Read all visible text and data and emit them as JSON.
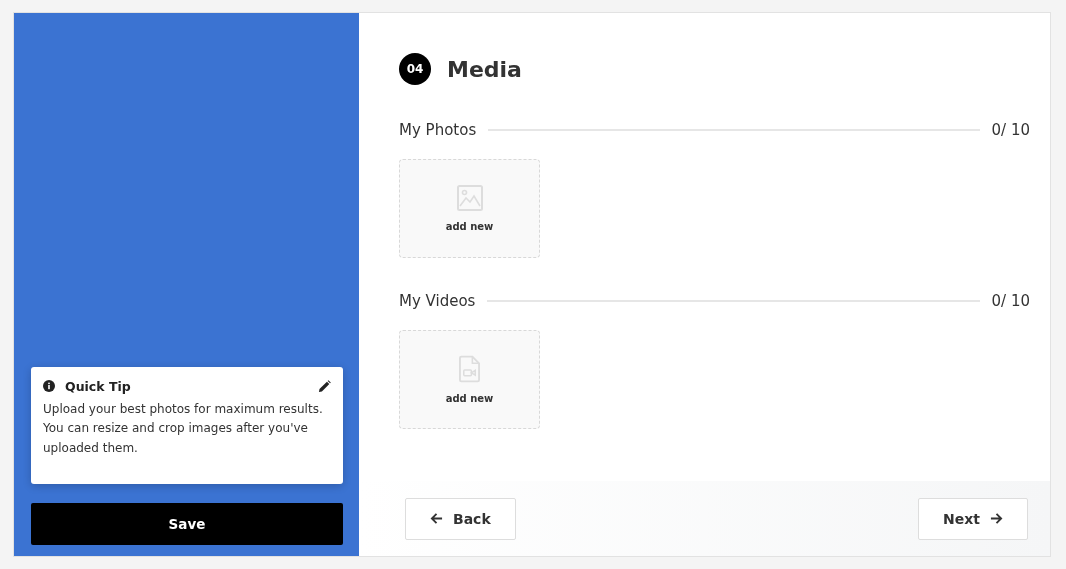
{
  "step": {
    "number": "04",
    "title": "Media"
  },
  "sections": [
    {
      "kind": "photo",
      "title": "My Photos",
      "count": "0/ 10",
      "tile_label": "add new"
    },
    {
      "kind": "video",
      "title": "My Videos",
      "count": "0/ 10",
      "tile_label": "add new"
    }
  ],
  "tip": {
    "title": "Quick Tip",
    "text": "Upload your best photos for maximum results. You can resize and crop images after you've uploaded them."
  },
  "save_button": "Save",
  "nav": {
    "back": "Back",
    "next": "Next"
  }
}
